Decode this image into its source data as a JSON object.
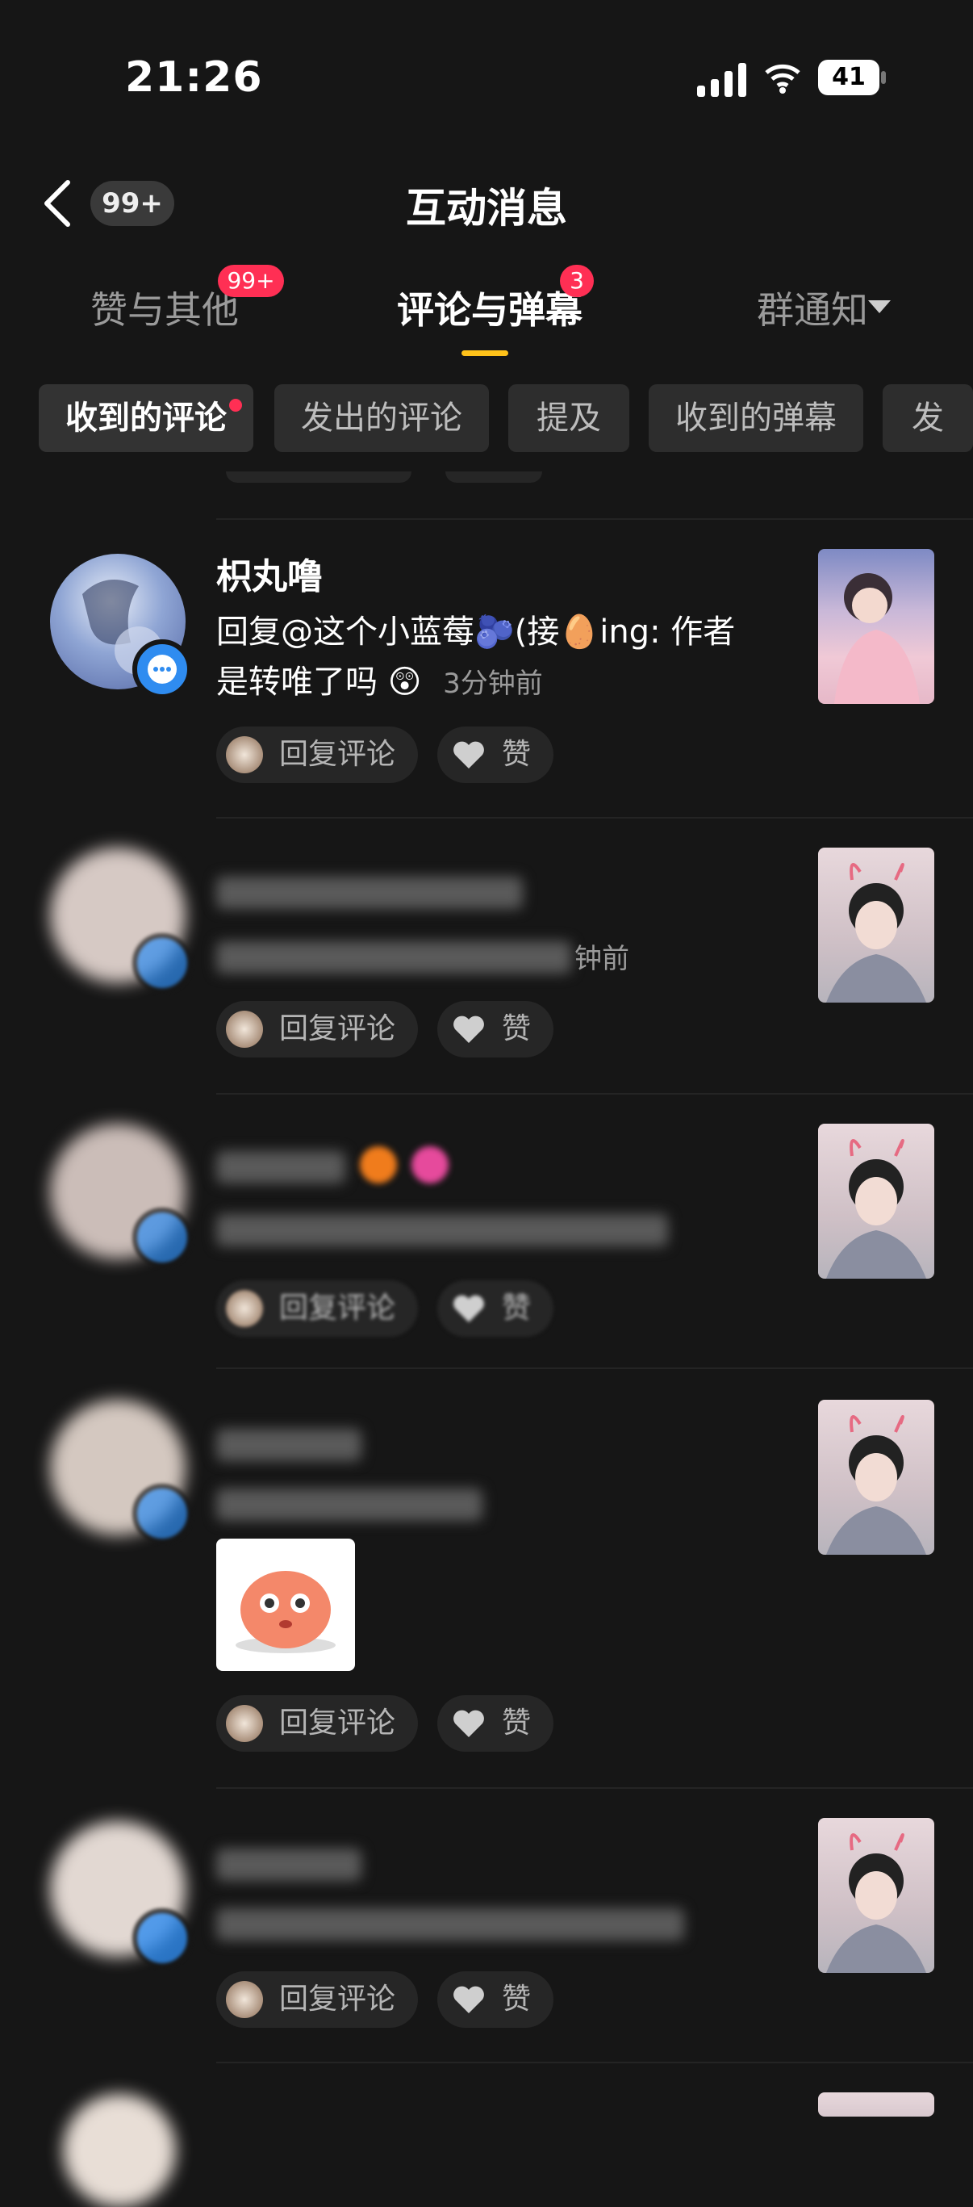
{
  "status_bar": {
    "time": "21:26",
    "battery": "41"
  },
  "header": {
    "back_badge": "99+",
    "title": "互动消息"
  },
  "tabs": [
    {
      "label": "赞与其他",
      "badge": "99+"
    },
    {
      "label": "评论与弹幕",
      "badge": "3"
    },
    {
      "label": "群通知"
    }
  ],
  "filters": [
    "收到的评论",
    "发出的评论",
    "提及",
    "收到的弹幕",
    "发"
  ],
  "items": [
    {
      "name": "枳丸噜",
      "content": "回复@这个小蓝莓🫐(接🥚ing: 作者是转唯了吗 😲",
      "time": "3分钟前",
      "reply_label": "回复评论",
      "like_label": "赞"
    },
    {
      "time_suffix": "钟前",
      "reply_label": "回复评论",
      "like_label": "赞"
    },
    {
      "reply_label": "回复评论",
      "like_label": "赞"
    },
    {
      "reply_label": "回复评论",
      "like_label": "赞"
    },
    {
      "reply_label": "回复评论",
      "like_label": "赞"
    }
  ],
  "colors": {
    "accent": "#ffc21a",
    "badge": "#ff2f54",
    "background": "#161616"
  }
}
